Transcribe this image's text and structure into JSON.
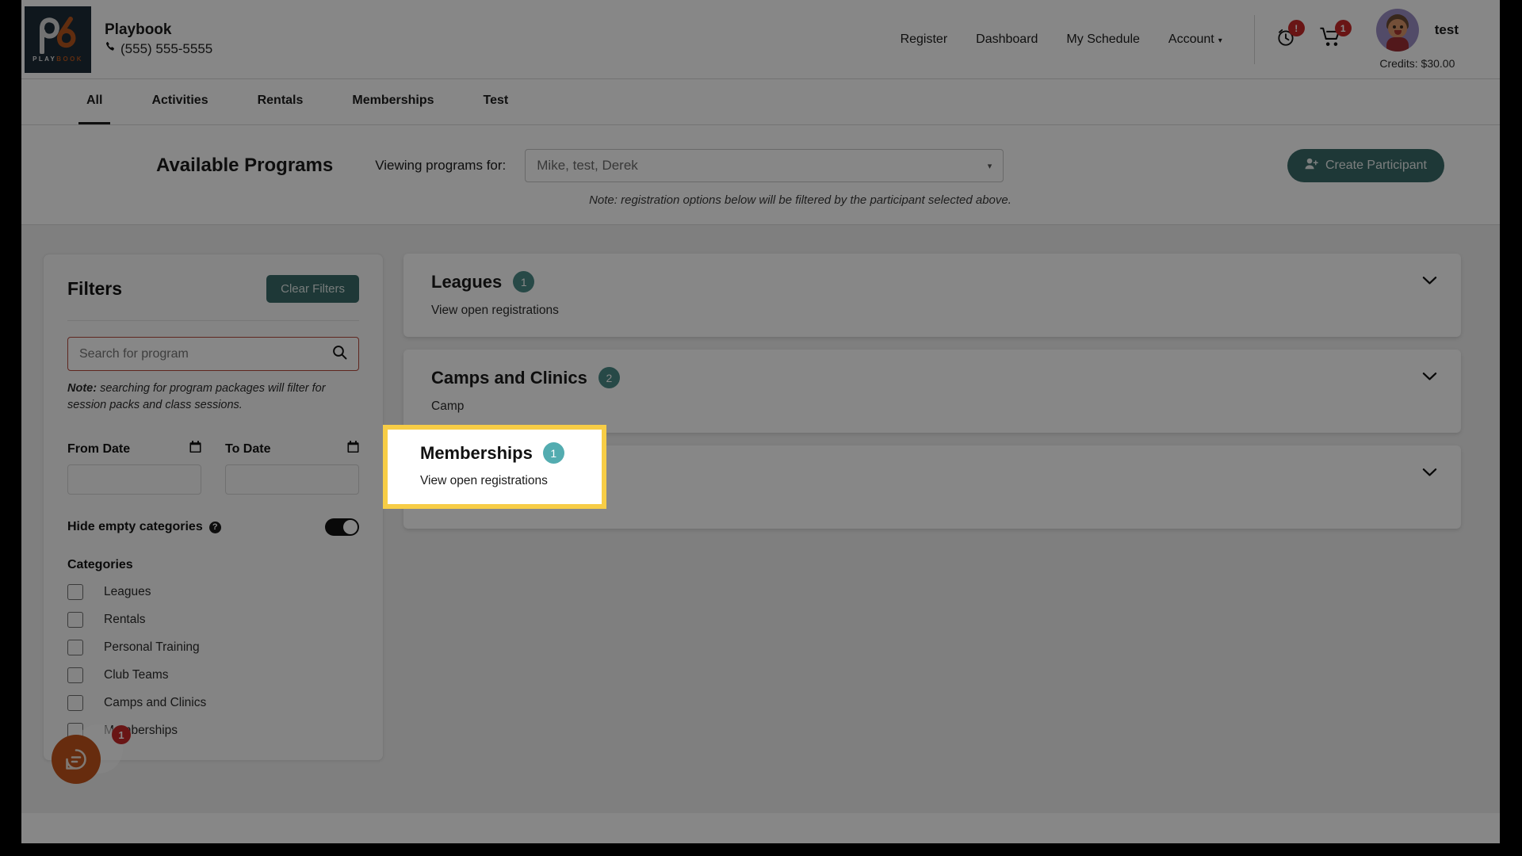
{
  "brand": {
    "logo_word_part1": "PLAY",
    "logo_word_part2": "BOOK",
    "name": "Playbook",
    "phone": "(555) 555-5555",
    "phone_icon": "phone-icon"
  },
  "nav": {
    "items": [
      {
        "label": "Register"
      },
      {
        "label": "Dashboard"
      },
      {
        "label": "My Schedule"
      },
      {
        "label": "Account",
        "has_caret": true
      }
    ],
    "caret": "▾"
  },
  "header_icons": {
    "history_icon": "clock-icon",
    "history_badge": "!",
    "cart_icon": "shopping-cart-icon",
    "cart_badge": "1"
  },
  "user": {
    "name": "test",
    "credits": "Credits: $30.00",
    "avatar": "user-avatar"
  },
  "tabs": [
    {
      "label": "All",
      "active": true
    },
    {
      "label": "Activities",
      "active": false
    },
    {
      "label": "Rentals",
      "active": false
    },
    {
      "label": "Memberships",
      "active": false
    },
    {
      "label": "Test",
      "active": false
    }
  ],
  "programs_bar": {
    "title": "Available Programs",
    "viewing_label": "Viewing programs for:",
    "participant_select_value": "Mike, test, Derek",
    "select_caret": "▾",
    "create_button": "Create Participant",
    "create_button_icon": "person-add-icon",
    "note": "Note: registration options below will be filtered by the participant selected above."
  },
  "filters": {
    "title": "Filters",
    "clear_label": "Clear Filters",
    "search_placeholder": "Search for program",
    "search_value": "",
    "search_icon": "search-icon",
    "note_bold": "Note:",
    "note_rest": " searching for program packages will filter for session packs and class sessions.",
    "from_date_label": "From Date",
    "to_date_label": "To Date",
    "from_date_value": "",
    "to_date_value": "",
    "calendar_icon": "calendar-icon",
    "hide_empty_label": "Hide empty categories",
    "help_icon": "help-icon",
    "help_glyph": "?",
    "hide_empty_on": true,
    "categories_title": "Categories",
    "categories": [
      {
        "label": "Leagues",
        "checked": false
      },
      {
        "label": "Rentals",
        "checked": false
      },
      {
        "label": "Personal Training",
        "checked": false
      },
      {
        "label": "Club Teams",
        "checked": false
      },
      {
        "label": "Camps and Clinics",
        "checked": false
      },
      {
        "label": "Memberships",
        "checked": false
      }
    ]
  },
  "program_cards": [
    {
      "title": "Leagues",
      "count": "1",
      "subtitle": "View open registrations",
      "chevron": "chevron-down-icon"
    },
    {
      "title": "Camps and Clinics",
      "count": "2",
      "subtitle": "Camp",
      "chevron": "chevron-down-icon"
    },
    {
      "title": "Memberships",
      "count": "1",
      "subtitle": "View open registrations",
      "chevron": "chevron-down-icon"
    }
  ],
  "highlight": {
    "title": "Memberships",
    "count": "1",
    "subtitle": "View open registrations",
    "border_color": "#f7cd46"
  },
  "chat": {
    "icon": "chat-bubble-icon",
    "badge": "1"
  },
  "colors": {
    "teal": "#3a6b68",
    "badge_teal": "#4a8a86",
    "red_badge": "#c62828",
    "highlight_yellow": "#f7cd46",
    "chat_orange": "#c2541b",
    "logo_navy": "#1e2c38"
  }
}
